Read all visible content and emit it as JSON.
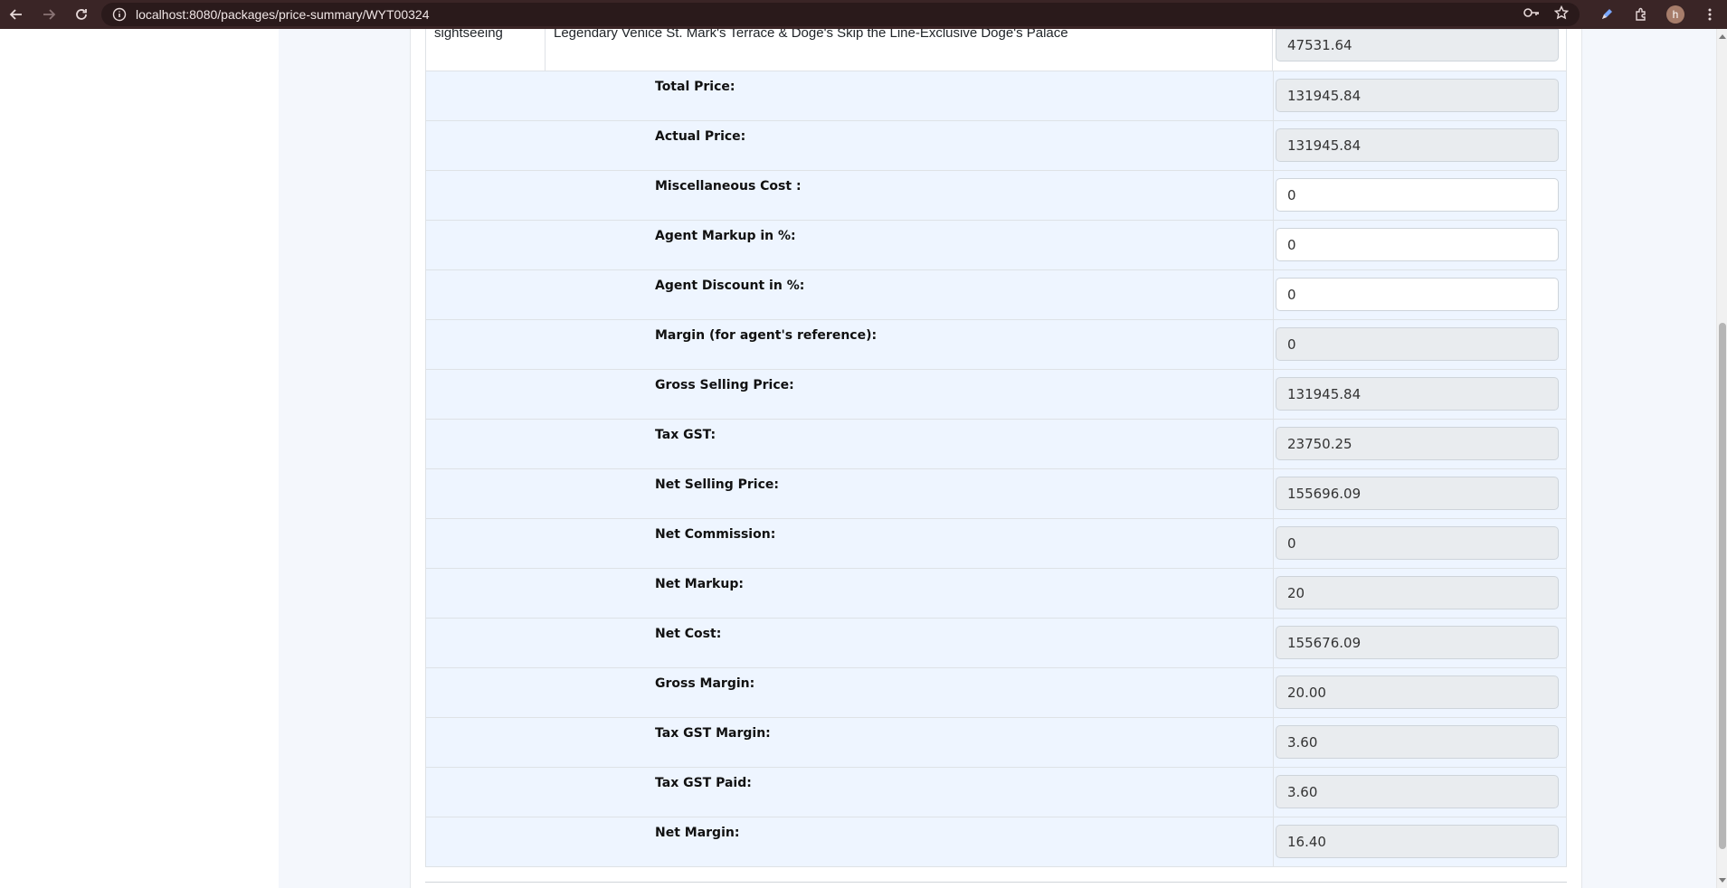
{
  "browser": {
    "url": "localhost:8080/packages/price-summary/WYT00324",
    "profile_initial": "h",
    "icons": [
      "back-icon",
      "forward-icon",
      "reload-icon",
      "site-info-icon",
      "password-key-icon",
      "bookmark-star-icon",
      "pen-icon",
      "extensions-icon",
      "menu-icon"
    ]
  },
  "first_row": {
    "type": "sightseeing",
    "description": "Legendary Venice St. Mark's Terrace & Doge's Skip the Line-Exclusive Doge's Palace",
    "price": "47531.64"
  },
  "summary_rows": [
    {
      "label": "Total Price:",
      "value": "131945.84",
      "editable": false
    },
    {
      "label": "Actual Price:",
      "value": "131945.84",
      "editable": false
    },
    {
      "label": "Miscellaneous Cost :",
      "value": "0",
      "editable": true
    },
    {
      "label": "Agent Markup in %:",
      "value": "0",
      "editable": true
    },
    {
      "label": "Agent Discount in %:",
      "value": "0",
      "editable": true
    },
    {
      "label": "Margin (for agent's reference):",
      "value": "0",
      "editable": false
    },
    {
      "label": "Gross Selling Price:",
      "value": "131945.84",
      "editable": false
    },
    {
      "label": "Tax GST:",
      "value": "23750.25",
      "editable": false
    },
    {
      "label": "Net Selling Price:",
      "value": "155696.09",
      "editable": false
    },
    {
      "label": "Net Commission:",
      "value": "0",
      "editable": false
    },
    {
      "label": "Net Markup:",
      "value": "20",
      "editable": false
    },
    {
      "label": "Net Cost:",
      "value": "155676.09",
      "editable": false
    },
    {
      "label": "Gross Margin:",
      "value": "20.00",
      "editable": false
    },
    {
      "label": "Tax GST Margin:",
      "value": "3.60",
      "editable": false
    },
    {
      "label": "Tax GST Paid:",
      "value": "3.60",
      "editable": false
    },
    {
      "label": "Net Margin:",
      "value": "16.40",
      "editable": false
    }
  ],
  "colors": {
    "chrome": "#3a2526",
    "page_bg": "#f4f7fc",
    "row_bg": "#eef5ff",
    "readonly_field": "#e9ecef"
  }
}
